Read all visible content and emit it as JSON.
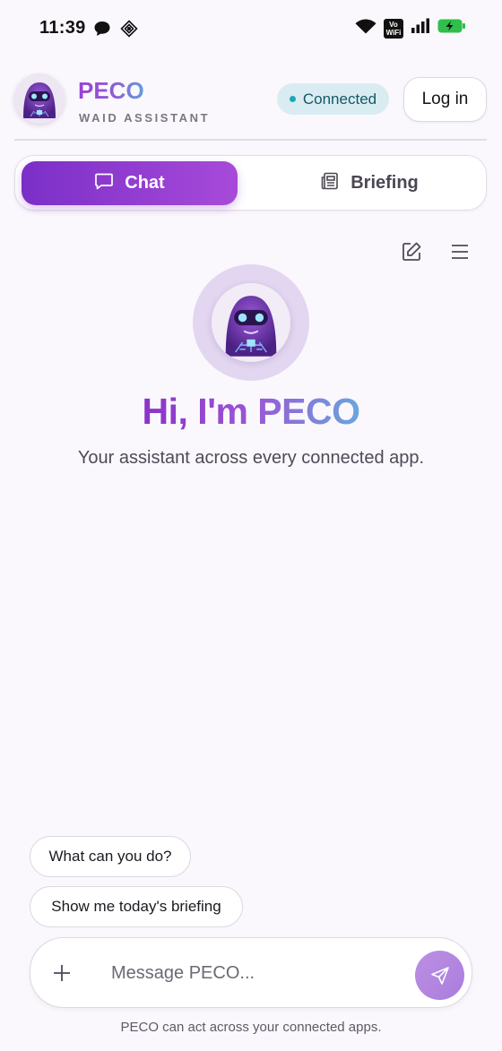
{
  "status_bar": {
    "time": "11:39",
    "network_label_top": "Vo",
    "network_label_bottom": "WiFi",
    "icons": [
      "chat-bubble-icon",
      "grid-app-icon",
      "wifi-icon",
      "vowifi-icon",
      "signal-icon",
      "battery-charging-icon"
    ]
  },
  "header": {
    "brand": "PECO",
    "subtitle": "WAID ASSISTANT",
    "status": "Connected",
    "login_label": "Log in"
  },
  "tabs": [
    {
      "label": "Chat",
      "icon": "chat-icon",
      "active": true
    },
    {
      "label": "Briefing",
      "icon": "newspaper-icon",
      "active": false
    }
  ],
  "toolbar": {
    "icons": [
      "edit-icon",
      "menu-icon"
    ]
  },
  "hero": {
    "greeting": "Hi, I'm PECO",
    "tagline": "Your assistant across every connected app."
  },
  "suggestions": [
    "What can you do?",
    "Show me today's briefing"
  ],
  "composer": {
    "placeholder": "Message PECO...",
    "value": ""
  },
  "footer_note": "PECO can act across your connected apps.",
  "colors": {
    "accent": "#8a33c9",
    "accent_gradient_end": "#69a6dc",
    "status_pill": "#d9ecf2",
    "status_dot": "#1aa9b8",
    "background": "#fbf8fd"
  }
}
